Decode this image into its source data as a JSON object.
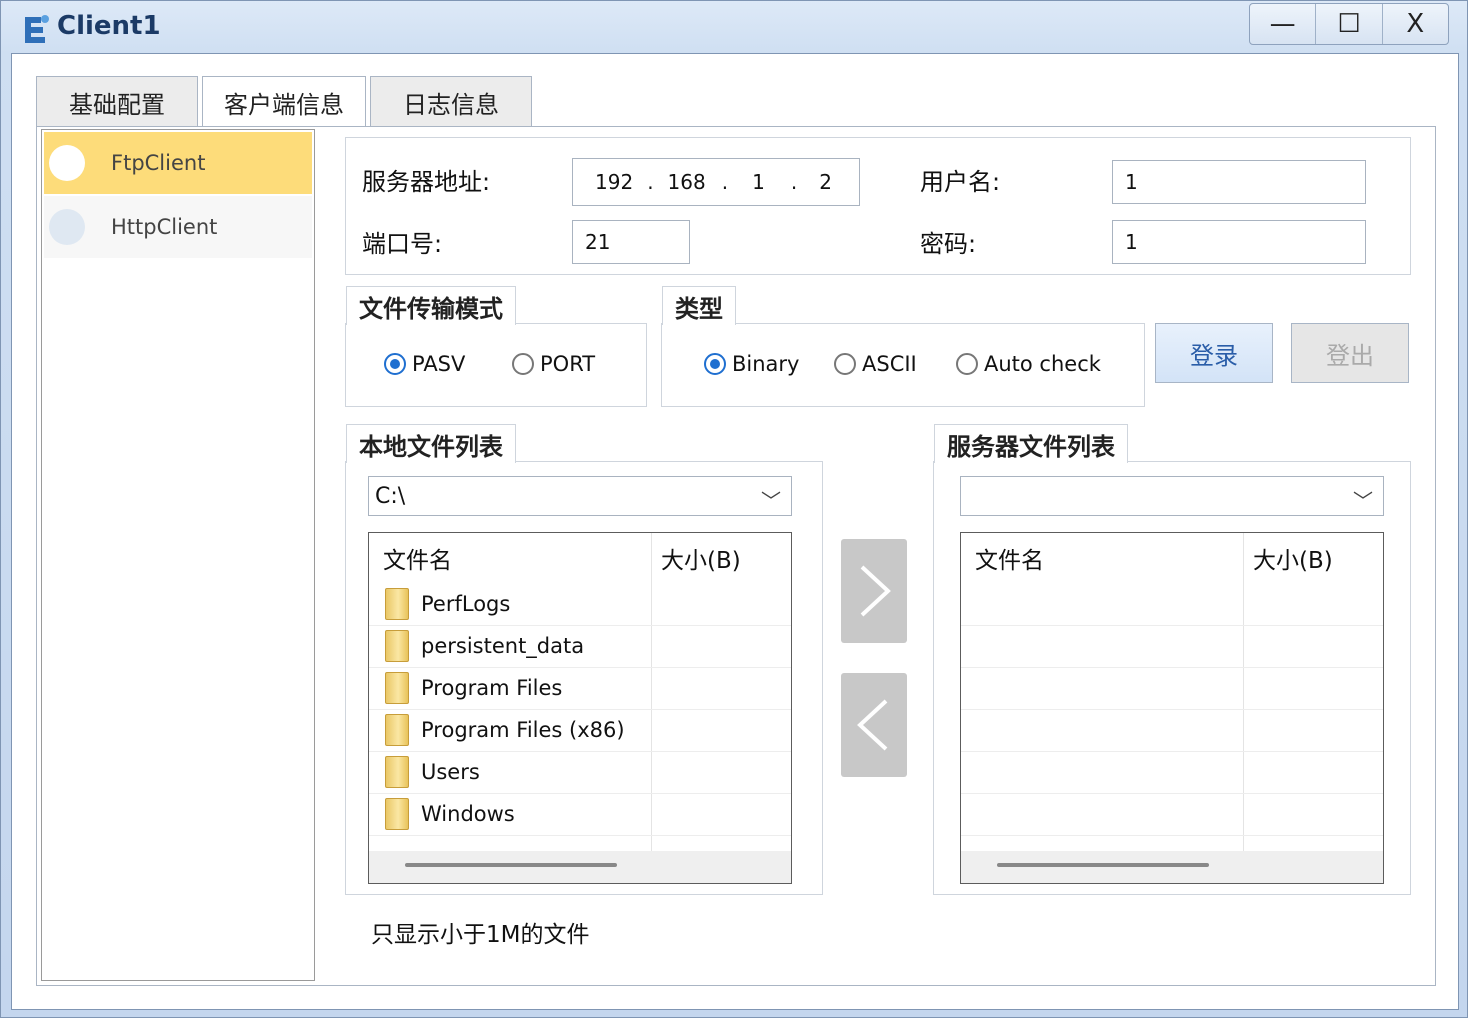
{
  "window": {
    "title": "Client1",
    "controls": {
      "minimize": "—",
      "maximize": "☐",
      "close": "X"
    }
  },
  "tabs": [
    {
      "label": "基础配置",
      "active": false
    },
    {
      "label": "客户端信息",
      "active": true
    },
    {
      "label": "日志信息",
      "active": false
    }
  ],
  "sidebar": {
    "items": [
      {
        "label": "FtpClient",
        "selected": true
      },
      {
        "label": "HttpClient",
        "selected": false
      }
    ]
  },
  "connection": {
    "server_label": "服务器地址:",
    "ip": [
      "192",
      "168",
      "1",
      "2"
    ],
    "ip_dot": ".",
    "user_label": "用户名:",
    "user_value": "1",
    "port_label": "端口号:",
    "port_value": "21",
    "password_label": "密码:",
    "password_value": "1"
  },
  "mode_group": {
    "title": "文件传输模式",
    "options": [
      {
        "label": "PASV",
        "checked": true
      },
      {
        "label": "PORT",
        "checked": false
      }
    ]
  },
  "type_group": {
    "title": "类型",
    "options": [
      {
        "label": "Binary",
        "checked": true
      },
      {
        "label": "ASCII",
        "checked": false
      },
      {
        "label": "Auto check",
        "checked": false
      }
    ]
  },
  "buttons": {
    "login": "登录",
    "logout": "登出"
  },
  "local": {
    "title": "本地文件列表",
    "path": "C:\\",
    "col_name": "文件名",
    "col_size": "大小(B)",
    "files": [
      "PerfLogs",
      "persistent_data",
      "Program Files",
      "Program Files (x86)",
      "Users",
      "Windows"
    ]
  },
  "server": {
    "title": "服务器文件列表",
    "path": "",
    "col_name": "文件名",
    "col_size": "大小(B)"
  },
  "note": "只显示小于1M的文件",
  "colors": {
    "selected_item": "#fddc7a",
    "accent": "#1f6fd0",
    "login_bg": "#dbe8f8"
  }
}
